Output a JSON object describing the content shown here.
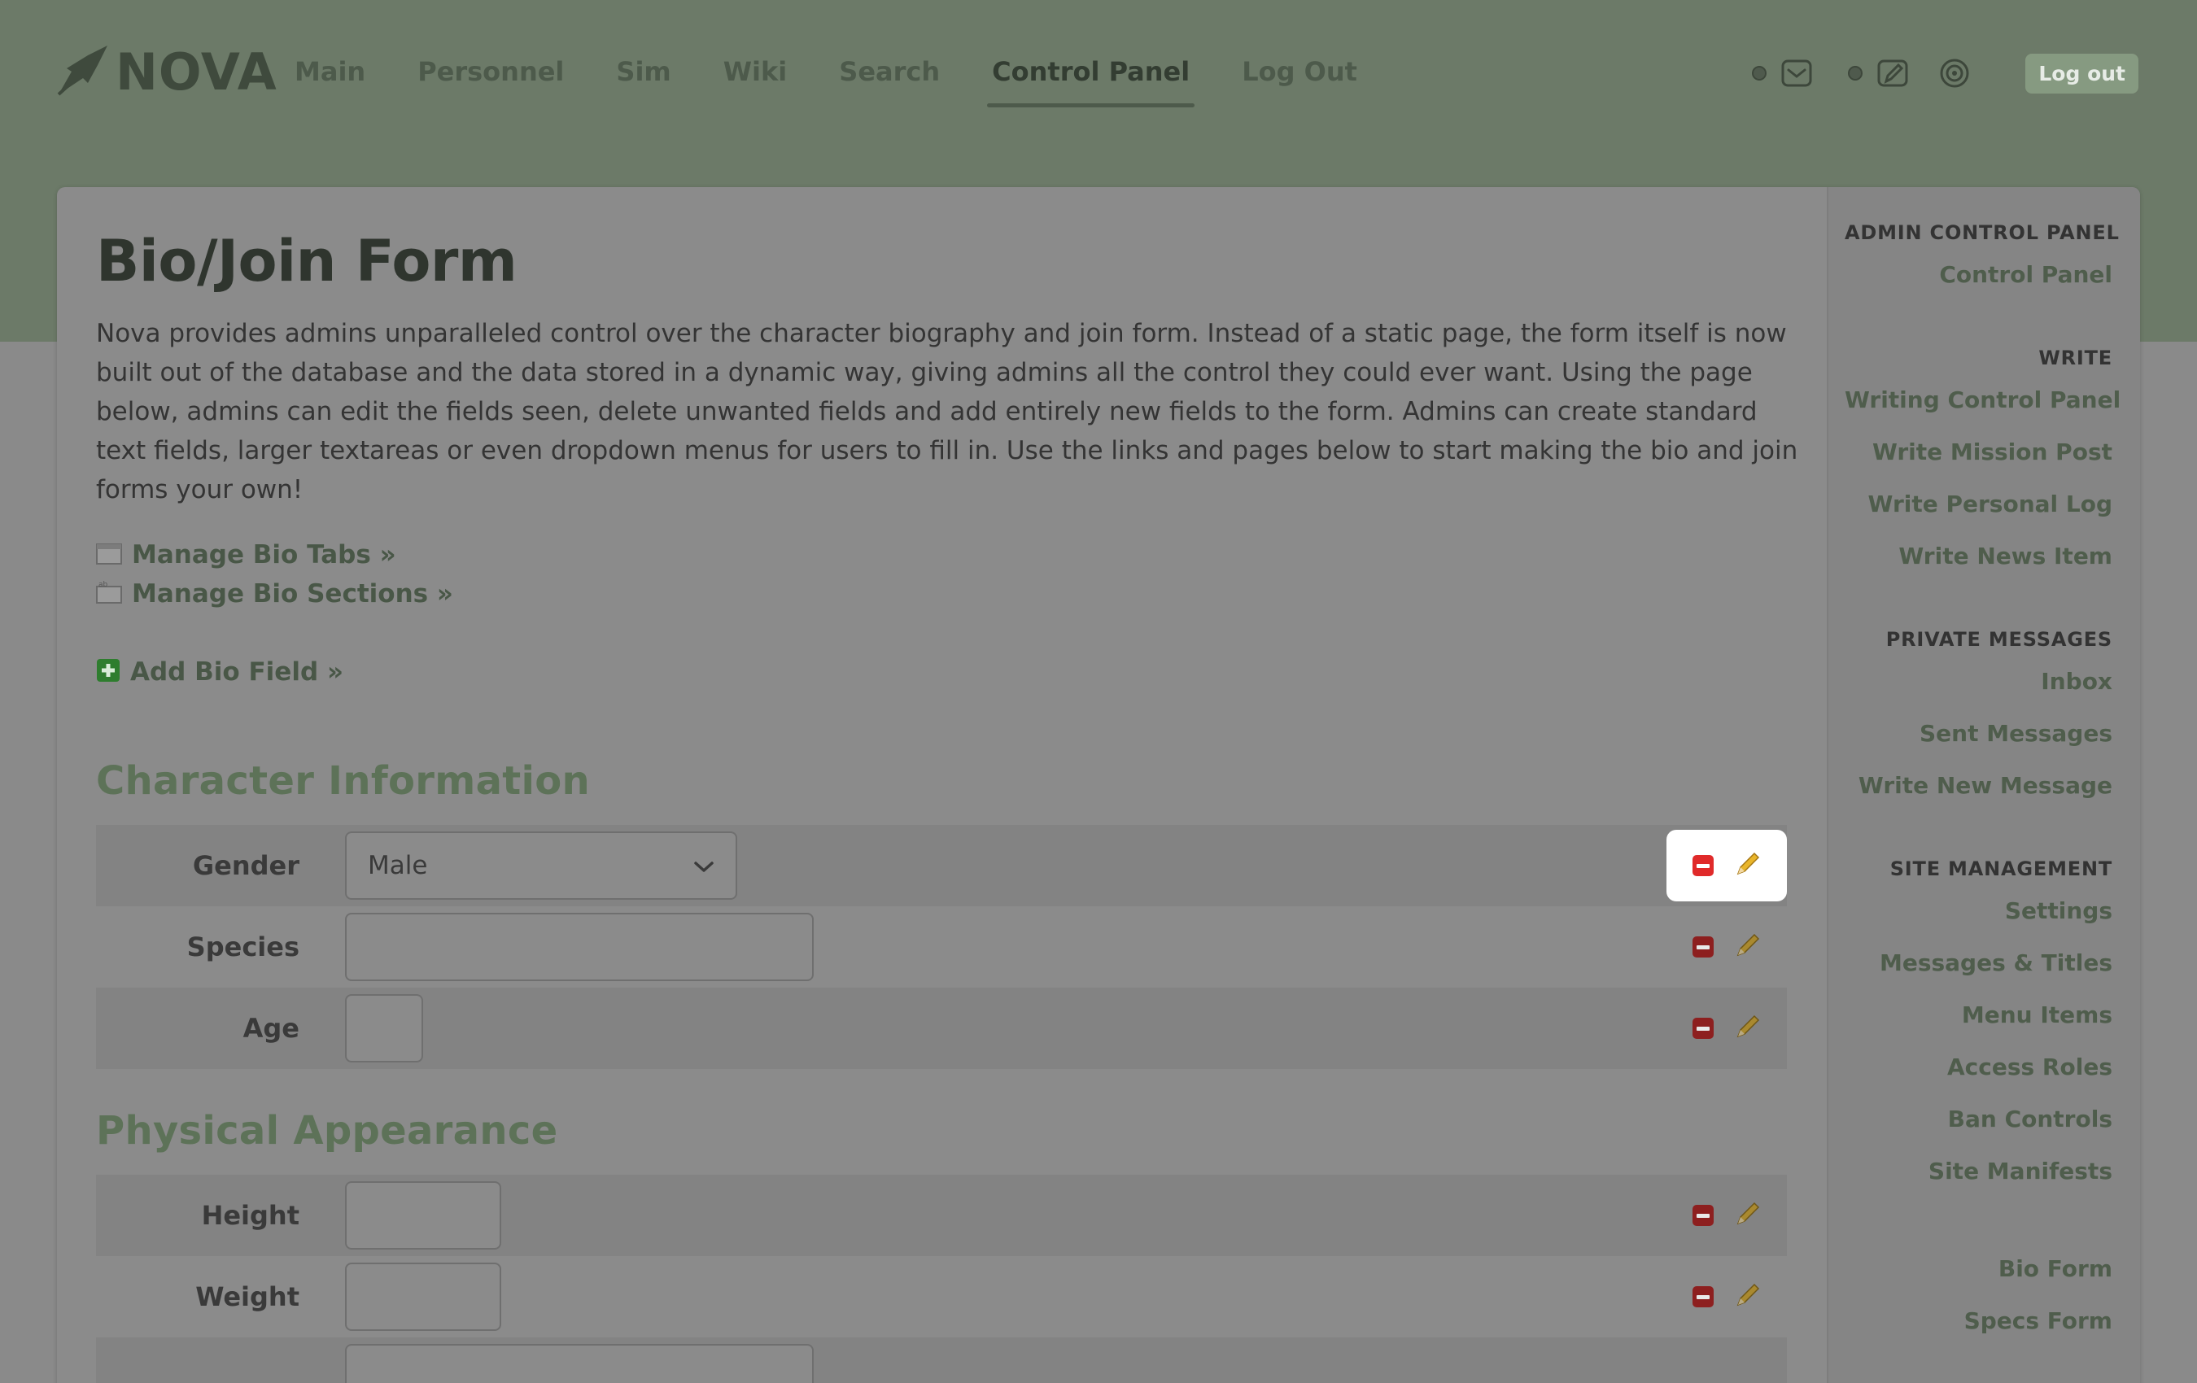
{
  "header": {
    "logo_text": "NOVA",
    "nav": [
      "Main",
      "Personnel",
      "Sim",
      "Wiki",
      "Search",
      "Control Panel",
      "Log Out"
    ],
    "active_nav": "Control Panel",
    "logout_button": "Log out",
    "icons": [
      "inbox-icon",
      "write-icon",
      "target-icon"
    ]
  },
  "page": {
    "title": "Bio/Join Form",
    "intro": "Nova provides admins unparalleled control over the character biography and join form. Instead of a static page, the form itself is now built out of the database and the data stored in a dynamic way, giving admins all the control they could ever want. Using the page below, admins can edit the fields seen, delete unwanted fields and add entirely new fields to the form. Admins can create standard text fields, larger textareas or even dropdown menus for users to fill in. Use the links and pages below to start making the bio and join forms your own!",
    "links": {
      "manage_tabs": "Manage Bio Tabs »",
      "manage_sections": "Manage Bio Sections »",
      "add_field": "Add Bio Field »"
    }
  },
  "sections": [
    {
      "title": "Character Information",
      "fields": [
        {
          "label": "Gender",
          "type": "select",
          "value": "Male"
        },
        {
          "label": "Species",
          "type": "text",
          "value": ""
        },
        {
          "label": "Age",
          "type": "text",
          "value": ""
        }
      ]
    },
    {
      "title": "Physical Appearance",
      "fields": [
        {
          "label": "Height",
          "type": "text",
          "value": ""
        },
        {
          "label": "Weight",
          "type": "text",
          "value": ""
        }
      ]
    }
  ],
  "sidebar": {
    "groups": [
      {
        "heading": "ADMIN CONTROL PANEL",
        "items": [
          "Control Panel"
        ]
      },
      {
        "heading": "WRITE",
        "items": [
          "Writing Control Panel",
          "Write Mission Post",
          "Write Personal Log",
          "Write News Item"
        ]
      },
      {
        "heading": "PRIVATE MESSAGES",
        "items": [
          "Inbox",
          "Sent Messages",
          "Write New Message"
        ]
      },
      {
        "heading": "SITE MANAGEMENT",
        "items": [
          "Settings",
          "Messages & Titles",
          "Menu Items",
          "Access Roles",
          "Ban Controls",
          "Site Manifests"
        ]
      },
      {
        "heading": "",
        "items": [
          "Bio Form",
          "Specs Form"
        ]
      }
    ]
  }
}
